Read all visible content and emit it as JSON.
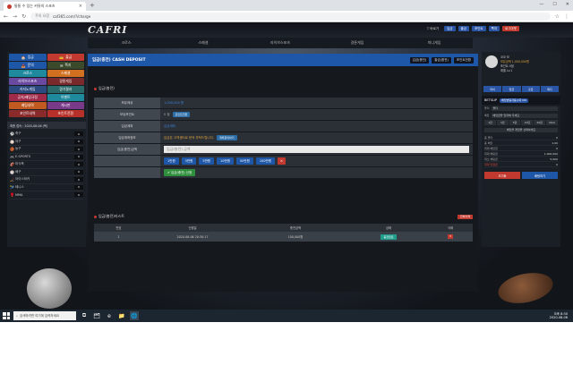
{
  "browser": {
    "tab_title": "통통 수 있는 커뮤의 스포츠",
    "url_prefix": "주의 요함",
    "url": "caf365.com/?/charge",
    "new_tab": "+",
    "win_controls": [
      "—",
      "☐",
      "✕"
    ]
  },
  "site": {
    "logo": "CAFRI",
    "user": {
      "name": "▽ 바로가",
      "buttons": [
        "입금",
        "출금",
        "포인트",
        "쪽지",
        "로그아웃"
      ]
    },
    "nav": [
      "크로스",
      "스페셜",
      "라이브스포츠",
      "경륜게임",
      "미니게임"
    ],
    "left_menu": [
      {
        "label": "입금",
        "icon": "🏠",
        "color": "#1e56a8"
      },
      {
        "label": "출금",
        "icon": "💳",
        "color": "#c23a2f"
      },
      {
        "label": "문의",
        "icon": "📥",
        "color": "#1e56a8"
      },
      {
        "label": "쪽지",
        "icon": "✉",
        "color": "#3a4a2a"
      },
      {
        "label": "크로스",
        "icon": "",
        "color": "#1f8a9e"
      },
      {
        "label": "스페셜",
        "icon": "",
        "color": "#d07020"
      },
      {
        "label": "라이브스포츠",
        "icon": "",
        "color": "#6a4aa0"
      },
      {
        "label": "경륜게임",
        "icon": "",
        "color": "#7a2a2a"
      },
      {
        "label": "카지노게임",
        "icon": "",
        "color": "#2a4a80"
      },
      {
        "label": "경기결과",
        "icon": "",
        "color": "#2a6a6a"
      },
      {
        "label": "공지/베팅규정",
        "icon": "",
        "color": "#a02a4a"
      },
      {
        "label": "이벤트",
        "icon": "",
        "color": "#1f8a9e"
      },
      {
        "label": "베팅내역",
        "icon": "",
        "color": "#c05a20"
      },
      {
        "label": "게시판",
        "icon": "",
        "color": "#7a3a8a"
      },
      {
        "label": "포인트내역",
        "icon": "",
        "color": "#8a2a2a"
      },
      {
        "label": "포인트전환",
        "icon": "",
        "color": "#b8302a"
      }
    ],
    "date_label": "최종 접속 : 2020-08-06 (목)",
    "sports": [
      {
        "icon": "⚽",
        "name": "축구",
        "count": "0"
      },
      {
        "icon": "⚾",
        "name": "야구",
        "count": "0"
      },
      {
        "icon": "🏀",
        "name": "농구",
        "count": "0"
      },
      {
        "icon": "🎮",
        "name": "E-SPORTS",
        "count": "0"
      },
      {
        "icon": "🏈",
        "name": "미식축",
        "count": "0"
      },
      {
        "icon": "🏐",
        "name": "배구",
        "count": "0"
      },
      {
        "icon": "🏒",
        "name": "아이스하키",
        "count": "0"
      },
      {
        "icon": "🎾",
        "name": "테니스",
        "count": "0"
      },
      {
        "icon": "🥊",
        "name": "MMA",
        "count": "0"
      }
    ],
    "main": {
      "title": "입금(충전) CASH DEPOSIT",
      "head_buttons": [
        "입금(충전)",
        "출금(환전)",
        "포인트전환"
      ],
      "sub_title": "입금(충전)",
      "form": {
        "labels": [
          "보유캐쉬",
          "보유포인트",
          "입금계좌",
          "입금계좌정보",
          "입금(충전)금액"
        ],
        "cash": "1,000,000 원",
        "point": "0 점",
        "point_btn": "포인트전환",
        "account": "입금계좌",
        "account_info": "입금은 고객센터로 문의 부탁드립니다.",
        "account_btn": "계좌문의하기",
        "amount_placeholder": "입금(충전) 금액",
        "amount_buttons": [
          "1만원",
          "3만원",
          "5만원",
          "10만원",
          "50만원",
          "100만원"
        ],
        "clear_btn": "✕",
        "submit": "✔ 입금(충전) 신청"
      },
      "list": {
        "title": "입금(충전)리스트",
        "delete_all": "전체삭제",
        "headers": [
          "번호",
          "신청일",
          "충전금액",
          "상태",
          "삭제"
        ],
        "rows": [
          {
            "no": "1",
            "date": "2020-08-06 20:30:17",
            "amount": "100,000원",
            "status": "충전완료",
            "del": "✕"
          }
        ]
      }
    },
    "right": {
      "name": "코코 보",
      "money": "보유금액 1,000,000원",
      "point": "포인트 0점",
      "level": "레벨 Lv.1",
      "tabs": [
        "마이",
        "입금",
        "출금",
        "쪽지"
      ],
      "betslip_title": "BETSLIP",
      "betslip_live": "배당변동자동수락 ON",
      "rows": [
        {
          "label": "폴더",
          "value": "폴더"
        },
        {
          "label": "배당",
          "value": "배당금을 입력해 주세요"
        }
      ],
      "bet_amounts": [
        "1만",
        "3만",
        "5만",
        "10만",
        "50만",
        "MAX"
      ],
      "auto_text": "배당을 게임을 선택하세요",
      "stats": [
        {
          "label": "총 폴더",
          "value": "0"
        },
        {
          "label": "총 배당",
          "value": "1.00"
        },
        {
          "label": "최대 배당금",
          "value": "0"
        },
        {
          "label": "최대 배팅금",
          "value": "1,000,000"
        },
        {
          "label": "최소 배팅금",
          "value": "5,000"
        },
        {
          "label": "최대 당첨금",
          "value": "0"
        }
      ],
      "btn_reset": "초기화",
      "btn_bet": "배팅하기"
    }
  },
  "taskbar": {
    "search": "검색하려면 여기에 입력하세요",
    "icons": [
      "⧉",
      "🗂",
      "e",
      "📁",
      "🌐"
    ],
    "time": "오후 8:30",
    "date": "2020-08-06"
  }
}
